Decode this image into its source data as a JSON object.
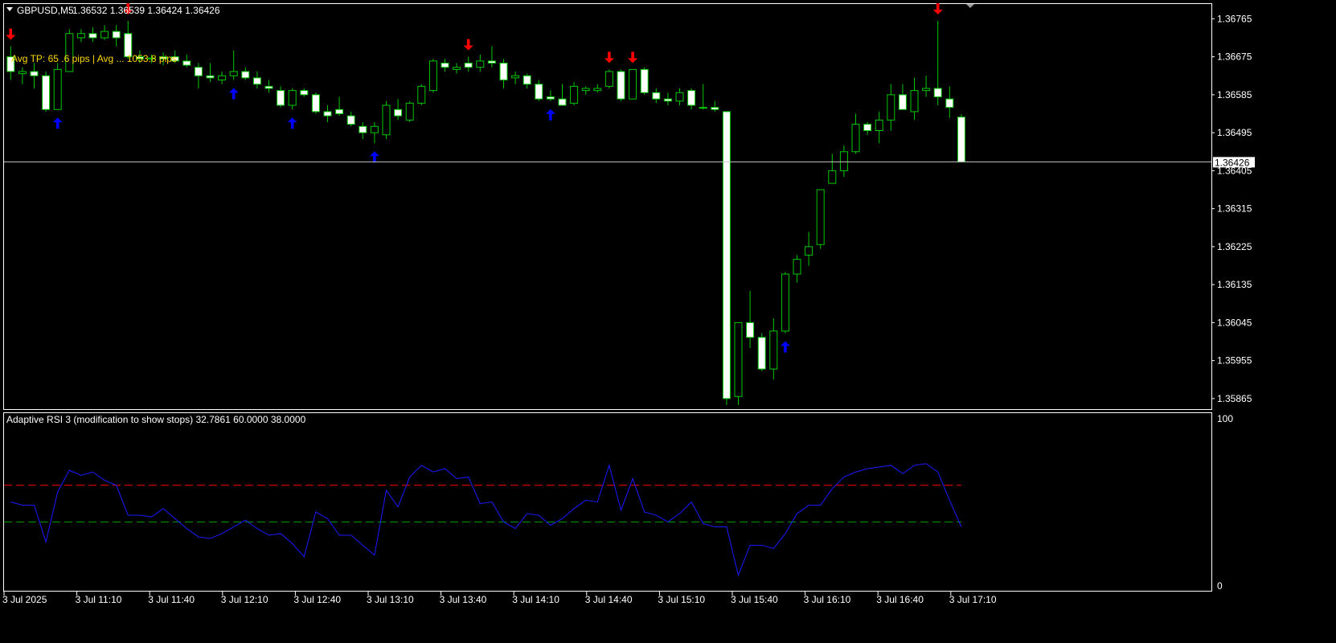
{
  "header": {
    "symbol": "GBPUSD,M5",
    "ohlc": "1.36532 1.36539 1.36424 1.36426"
  },
  "overlay_text": "Avg TP: 65 .6 pips | Avg ... 1053.8 pips",
  "current_price_label": "1.36426",
  "indicator": {
    "title": "Adaptive RSI 3 (modification to show stops) 32.7861 60.0000 38.0000",
    "scale_max": "100",
    "scale_min": "0"
  },
  "colors": {
    "background": "#000000",
    "grid_border": "#ffffff",
    "bull_candle": "#00c800",
    "bear_candle_body": "#ffffff",
    "buy_arrow": "#0000ff",
    "sell_arrow": "#ff0000",
    "rsi_line": "#1a1aff",
    "level_high": "#ff0000",
    "level_low": "#00a000"
  },
  "chart_data": [
    {
      "type": "candlestick",
      "title": "GBPUSD,M5",
      "ylim": [
        1.3584,
        1.368
      ],
      "y_ticks": [
        "1.36765",
        "1.36675",
        "1.36585",
        "1.36495",
        "1.36405",
        "1.36315",
        "1.36225",
        "1.36135",
        "1.36045",
        "1.35955",
        "1.35865"
      ],
      "x_ticks": [
        "3 Jul 2025",
        "3 Jul 11:10",
        "3 Jul 11:40",
        "3 Jul 12:10",
        "3 Jul 12:40",
        "3 Jul 13:10",
        "3 Jul 13:40",
        "3 Jul 14:10",
        "3 Jul 14:40",
        "3 Jul 15:10",
        "3 Jul 15:40",
        "3 Jul 16:10",
        "3 Jul 16:40",
        "3 Jul 17:10"
      ],
      "current_price": 1.36426,
      "candles": [
        [
          1.36675,
          1.367,
          1.3662,
          1.3664
        ],
        [
          1.36635,
          1.3665,
          1.3661,
          1.3664
        ],
        [
          1.3664,
          1.3666,
          1.366,
          1.3663
        ],
        [
          1.3663,
          1.3664,
          1.36545,
          1.3655
        ],
        [
          1.3655,
          1.3666,
          1.3655,
          1.36645
        ],
        [
          1.3664,
          1.3674,
          1.3664,
          1.3673
        ],
        [
          1.3672,
          1.3674,
          1.3671,
          1.3673
        ],
        [
          1.3673,
          1.36745,
          1.3671,
          1.3672
        ],
        [
          1.3672,
          1.3675,
          1.36715,
          1.36735
        ],
        [
          1.36735,
          1.3675,
          1.367,
          1.3672
        ],
        [
          1.3673,
          1.3676,
          1.3667,
          1.36675
        ],
        [
          1.36675,
          1.3669,
          1.3666,
          1.3667
        ],
        [
          1.3667,
          1.3668,
          1.3666,
          1.36672
        ],
        [
          1.36675,
          1.36685,
          1.36655,
          1.3667
        ],
        [
          1.36675,
          1.3669,
          1.3666,
          1.36665
        ],
        [
          1.36665,
          1.3668,
          1.3665,
          1.36655
        ],
        [
          1.3665,
          1.3666,
          1.366,
          1.3663
        ],
        [
          1.3663,
          1.3666,
          1.36615,
          1.36625
        ],
        [
          1.3662,
          1.3664,
          1.3661,
          1.3663
        ],
        [
          1.3663,
          1.3669,
          1.3662,
          1.3664
        ],
        [
          1.3664,
          1.3665,
          1.3662,
          1.36625
        ],
        [
          1.36625,
          1.3664,
          1.366,
          1.3661
        ],
        [
          1.36605,
          1.3662,
          1.3659,
          1.366
        ],
        [
          1.36595,
          1.36605,
          1.36555,
          1.3656
        ],
        [
          1.3656,
          1.366,
          1.3655,
          1.36595
        ],
        [
          1.36595,
          1.366,
          1.3658,
          1.36585
        ],
        [
          1.36585,
          1.3659,
          1.3654,
          1.36545
        ],
        [
          1.36545,
          1.3656,
          1.3652,
          1.36535
        ],
        [
          1.3655,
          1.3658,
          1.36535,
          1.3654
        ],
        [
          1.36535,
          1.36545,
          1.3651,
          1.36515
        ],
        [
          1.3651,
          1.3652,
          1.3648,
          1.36495
        ],
        [
          1.36495,
          1.3652,
          1.3647,
          1.3651
        ],
        [
          1.3649,
          1.3657,
          1.3648,
          1.3656
        ],
        [
          1.3655,
          1.36575,
          1.36525,
          1.36535
        ],
        [
          1.36525,
          1.3657,
          1.3652,
          1.36565
        ],
        [
          1.36565,
          1.3661,
          1.3656,
          1.36605
        ],
        [
          1.36595,
          1.3667,
          1.3659,
          1.36665
        ],
        [
          1.3666,
          1.3667,
          1.3664,
          1.3665
        ],
        [
          1.36645,
          1.3666,
          1.36635,
          1.3665
        ],
        [
          1.3666,
          1.36675,
          1.3664,
          1.3665
        ],
        [
          1.3665,
          1.3668,
          1.3664,
          1.36665
        ],
        [
          1.36665,
          1.367,
          1.3665,
          1.3666
        ],
        [
          1.3666,
          1.3667,
          1.366,
          1.3662
        ],
        [
          1.36625,
          1.3664,
          1.3661,
          1.3663
        ],
        [
          1.3663,
          1.36635,
          1.366,
          1.3661
        ],
        [
          1.3661,
          1.3662,
          1.3657,
          1.36575
        ],
        [
          1.3658,
          1.36595,
          1.3657,
          1.36575
        ],
        [
          1.36575,
          1.3661,
          1.3657,
          1.3656
        ],
        [
          1.36565,
          1.36615,
          1.3656,
          1.36605
        ],
        [
          1.36595,
          1.36605,
          1.36585,
          1.366
        ],
        [
          1.36595,
          1.3661,
          1.3659,
          1.366
        ],
        [
          1.36605,
          1.36645,
          1.366,
          1.3664
        ],
        [
          1.3664,
          1.36645,
          1.3657,
          1.36575
        ],
        [
          1.36575,
          1.36645,
          1.36575,
          1.36645
        ],
        [
          1.36645,
          1.3665,
          1.36585,
          1.3659
        ],
        [
          1.3659,
          1.366,
          1.36565,
          1.36575
        ],
        [
          1.36575,
          1.3659,
          1.3656,
          1.3657
        ],
        [
          1.3657,
          1.366,
          1.3656,
          1.3659
        ],
        [
          1.36595,
          1.366,
          1.3655,
          1.3656
        ],
        [
          1.36555,
          1.3661,
          1.3655,
          1.36555
        ],
        [
          1.36555,
          1.3657,
          1.36545,
          1.3655
        ],
        [
          1.36545,
          1.36545,
          1.3585,
          1.35865
        ],
        [
          1.3587,
          1.3604,
          1.3585,
          1.36045
        ],
        [
          1.36045,
          1.3612,
          1.35985,
          1.3601
        ],
        [
          1.3601,
          1.3602,
          1.3593,
          1.35935
        ],
        [
          1.35935,
          1.36055,
          1.3591,
          1.36025
        ],
        [
          1.36025,
          1.36165,
          1.3602,
          1.3616
        ],
        [
          1.3616,
          1.36205,
          1.3614,
          1.36195
        ],
        [
          1.36205,
          1.3626,
          1.3618,
          1.36225
        ],
        [
          1.3623,
          1.3636,
          1.3622,
          1.3636
        ],
        [
          1.36375,
          1.36445,
          1.36375,
          1.36405
        ],
        [
          1.36405,
          1.36465,
          1.3639,
          1.3645
        ],
        [
          1.3645,
          1.3654,
          1.36445,
          1.36515
        ],
        [
          1.36515,
          1.3652,
          1.3649,
          1.365
        ],
        [
          1.365,
          1.36545,
          1.3647,
          1.36525
        ],
        [
          1.36525,
          1.3661,
          1.365,
          1.36585
        ],
        [
          1.36585,
          1.3661,
          1.3655,
          1.3655
        ],
        [
          1.36545,
          1.36625,
          1.36525,
          1.36595
        ],
        [
          1.36595,
          1.3663,
          1.3658,
          1.366
        ],
        [
          1.366,
          1.3676,
          1.3656,
          1.3658
        ],
        [
          1.36575,
          1.36605,
          1.3653,
          1.36555
        ],
        [
          1.36532,
          1.36539,
          1.36424,
          1.36426
        ]
      ],
      "sell_arrows": [
        0,
        10,
        39,
        51,
        53,
        79
      ],
      "buy_arrows": [
        4,
        19,
        24,
        31,
        46,
        66
      ]
    },
    {
      "type": "line",
      "title": "Adaptive RSI 3 (modification to show stops) 32.7861 60.0000 38.0000",
      "ylim": [
        0,
        100
      ],
      "levels": [
        60,
        38
      ],
      "series": [
        {
          "values": [
            50,
            48,
            48,
            26,
            56,
            69,
            66,
            68,
            63,
            60,
            42,
            42,
            41,
            46,
            40,
            34,
            29,
            28,
            31,
            35,
            39,
            34,
            30,
            31,
            25,
            17,
            44,
            40,
            30,
            30,
            24,
            18,
            57,
            47,
            65,
            72,
            68,
            70,
            64,
            65,
            49,
            50,
            38,
            34,
            43,
            42,
            36,
            40,
            46,
            51,
            50,
            72,
            45,
            64,
            44,
            42,
            38,
            43,
            50,
            37,
            35,
            35,
            6,
            24,
            24,
            22,
            31,
            43,
            48,
            48,
            58,
            65,
            68,
            70,
            71,
            72,
            67,
            72,
            73,
            68,
            51,
            35
          ]
        }
      ]
    }
  ]
}
